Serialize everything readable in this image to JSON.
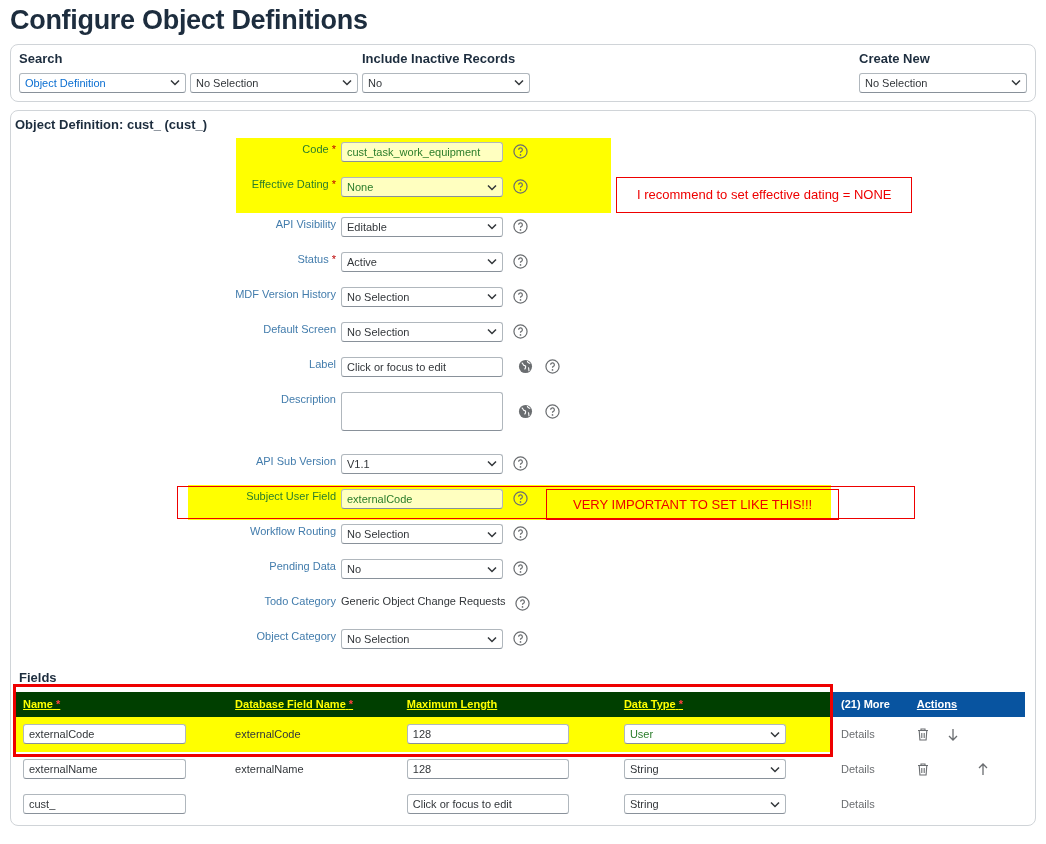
{
  "page_title": "Configure Object Definitions",
  "search_panel": {
    "groups": [
      {
        "heading": "Search",
        "selects": [
          {
            "value": "Object Definition",
            "link": true
          },
          {
            "value": "No Selection",
            "link": false
          }
        ]
      },
      {
        "heading": "Include Inactive Records",
        "selects": [
          {
            "value": "No",
            "link": false
          }
        ]
      },
      {
        "heading": "Create New",
        "selects": [
          {
            "value": "No Selection",
            "link": false
          }
        ]
      }
    ]
  },
  "definition": {
    "title": "Object Definition: cust_ (cust_)",
    "properties": [
      {
        "label": "Code",
        "required_mark": "*",
        "kind": "text",
        "value": "cust_task_work_equipment",
        "globe": false,
        "highlighted": true,
        "outlined": false
      },
      {
        "label": "Effective Dating",
        "required_mark": "*",
        "kind": "select",
        "value": "None",
        "globe": false,
        "highlighted": true,
        "outlined": false,
        "note": "I recommend to set effective dating =  NONE"
      },
      {
        "label": "API Visibility",
        "kind": "select",
        "value": "Editable",
        "globe": false,
        "highlighted": false,
        "outlined": false
      },
      {
        "label": "Status",
        "required_mark": "*",
        "kind": "select",
        "value": "Active",
        "globe": false,
        "highlighted": false,
        "outlined": false
      },
      {
        "label": "MDF Version History",
        "kind": "select",
        "value": "No Selection",
        "globe": false,
        "highlighted": false,
        "outlined": false
      },
      {
        "label": "Default Screen",
        "kind": "select",
        "value": "No Selection",
        "globe": false,
        "highlighted": false,
        "outlined": false
      },
      {
        "label": "Label",
        "kind": "text",
        "value": "Click or focus to edit",
        "globe": true,
        "highlighted": false,
        "outlined": false
      },
      {
        "label": "Description",
        "kind": "textarea",
        "globe": true,
        "highlighted": false,
        "outlined": false
      },
      {
        "label": "API Sub Version",
        "kind": "select",
        "value": "V1.1",
        "globe": false,
        "highlighted": false,
        "outlined": false
      },
      {
        "label": "Subject User Field",
        "kind": "text",
        "value": "externalCode",
        "globe": false,
        "highlighted": true,
        "outlined": true,
        "note": "VERY IMPORTANT TO SET LIKE THIS!!!"
      },
      {
        "label": "Workflow Routing",
        "kind": "select",
        "value": "No Selection",
        "globe": false,
        "highlighted": false,
        "outlined": false
      },
      {
        "label": "Pending Data",
        "kind": "select",
        "value": "No",
        "globe": false,
        "highlighted": false,
        "outlined": false
      },
      {
        "label": "Todo Category",
        "kind": "static",
        "value": "Generic Object Change Requests",
        "globe": false,
        "highlighted": false,
        "outlined": false
      },
      {
        "label": "Object Category",
        "kind": "select",
        "value": "No Selection",
        "globe": false,
        "highlighted": false,
        "outlined": false
      }
    ]
  },
  "fields": {
    "heading": "Fields",
    "columns": [
      {
        "label": "Name",
        "required_mark": "*",
        "highlighted": true
      },
      {
        "label": "Database Field Name",
        "required_mark": "*",
        "highlighted": true
      },
      {
        "label": "Maximum Length",
        "highlighted": true
      },
      {
        "label": "Data Type",
        "required_mark": "*",
        "highlighted": true
      },
      {
        "label": "(21) More",
        "highlighted": false
      },
      {
        "label": "Actions",
        "highlighted": false
      }
    ],
    "rows": [
      {
        "name": "externalCode",
        "db_name": "externalCode",
        "max_length": "128",
        "data_type": "User",
        "details": "Details",
        "delete": true,
        "move_down": true,
        "move_up": false,
        "highlighted": true
      },
      {
        "name": "externalName",
        "db_name": "externalName",
        "max_length": "128",
        "data_type": "String",
        "details": "Details",
        "delete": true,
        "move_down": false,
        "move_up": true,
        "highlighted": false
      },
      {
        "name": "cust_",
        "max_length": "Click or focus to edit",
        "data_type": "String",
        "details": "Details",
        "delete": false,
        "move_down": false,
        "move_up": false,
        "highlighted": false
      }
    ]
  }
}
